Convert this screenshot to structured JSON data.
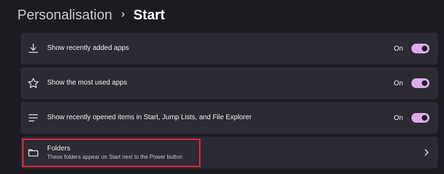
{
  "breadcrumb": {
    "parent": "Personalisation",
    "separator": "›",
    "current": "Start"
  },
  "settings": [
    {
      "icon": "download-icon",
      "label": "Show recently added apps",
      "state": "On",
      "enabled": true
    },
    {
      "icon": "star-icon",
      "label": "Show the most used apps",
      "state": "On",
      "enabled": true
    },
    {
      "icon": "list-icon",
      "label": "Show recently opened items in Start, Jump Lists, and File Explorer",
      "state": "On",
      "enabled": true
    }
  ],
  "folders": {
    "icon": "folder-icon",
    "title": "Folders",
    "subtitle": "These folders appear on Start next to the Power button",
    "highlighted": true
  },
  "colors": {
    "background": "#1c1b22",
    "card": "#2c2b33",
    "accent": "#e0a9ee",
    "highlight": "#e5283a"
  }
}
